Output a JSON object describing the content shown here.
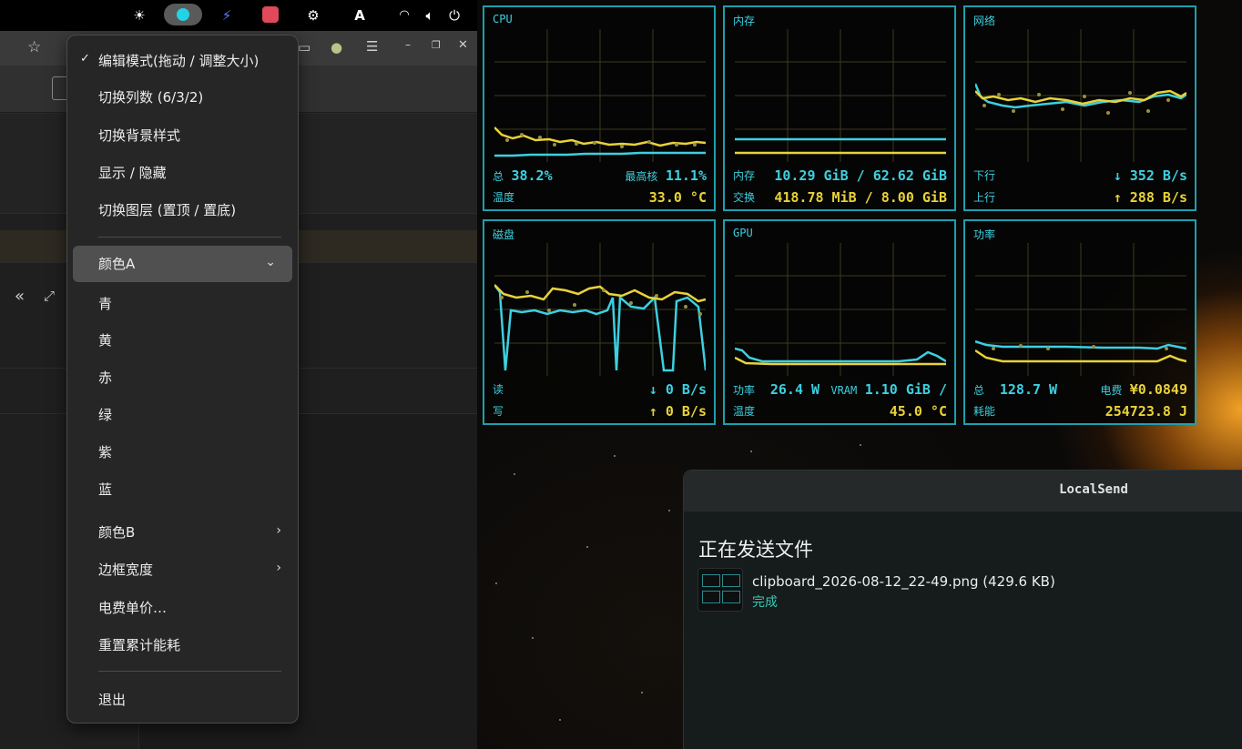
{
  "tray": {
    "icons": [
      "brightness-icon",
      "toggle-icon",
      "feather-icon",
      "app-red-icon",
      "steam-icon",
      "font-a-icon",
      "wifi-icon",
      "volume-icon",
      "power-icon"
    ],
    "font_label": "A"
  },
  "menu": {
    "items": [
      {
        "label": "编辑模式(拖动 / 调整大小)",
        "checked": true
      },
      {
        "label": "切换列数 (6/3/2)"
      },
      {
        "label": "切换背景样式"
      },
      {
        "label": "显示 / 隐藏"
      },
      {
        "label": "切换图层 (置顶 / 置底)"
      }
    ],
    "color_a": {
      "label": "颜色A",
      "expanded": true
    },
    "color_options": [
      "青",
      "黄",
      "赤",
      "绿",
      "紫",
      "蓝"
    ],
    "color_b": "颜色B",
    "border_width": "边框宽度",
    "price": "电费单价…",
    "reset": "重置累计能耗",
    "quit": "退出"
  },
  "monitor": {
    "colors": {
      "cyan": "#3cd0e0",
      "yellow": "#e8d23a",
      "border": "#1e9fae"
    },
    "cpu": {
      "title": "CPU",
      "total_label": "总",
      "total": "38.2%",
      "max_core_label": "最高核",
      "max_core": "11.1%",
      "temp_label": "温度",
      "temp": "33.0 °C"
    },
    "mem": {
      "title": "内存",
      "mem_label": "内存",
      "mem": "10.29 GiB / 62.62 GiB",
      "swap_label": "交换",
      "swap": "418.78 MiB / 8.00 GiB"
    },
    "net": {
      "title": "网络",
      "down_label": "下行",
      "down": "↓ 352 B/s",
      "up_label": "上行",
      "up": "↑ 288 B/s"
    },
    "disk": {
      "title": "磁盘",
      "read_label": "读",
      "read": "↓ 0 B/s",
      "write_label": "写",
      "write": "↑ 0 B/s"
    },
    "gpu": {
      "title": "GPU",
      "power_label": "功率",
      "power": "26.4 W",
      "vram_label": "VRAM",
      "vram": "1.10 GiB /",
      "temp_label": "温度",
      "temp": "45.0 °C"
    },
    "power": {
      "title": "功率",
      "total_label": "总",
      "total": "128.7 W",
      "cost_label": "电费",
      "cost": "¥0.0849",
      "energy_label": "耗能",
      "energy": "254723.8 J"
    }
  },
  "localsend": {
    "title": "LocalSend",
    "heading": "正在发送文件",
    "file": "clipboard_2026-08-12_22-49.png (429.6 KB)",
    "status": "完成"
  }
}
